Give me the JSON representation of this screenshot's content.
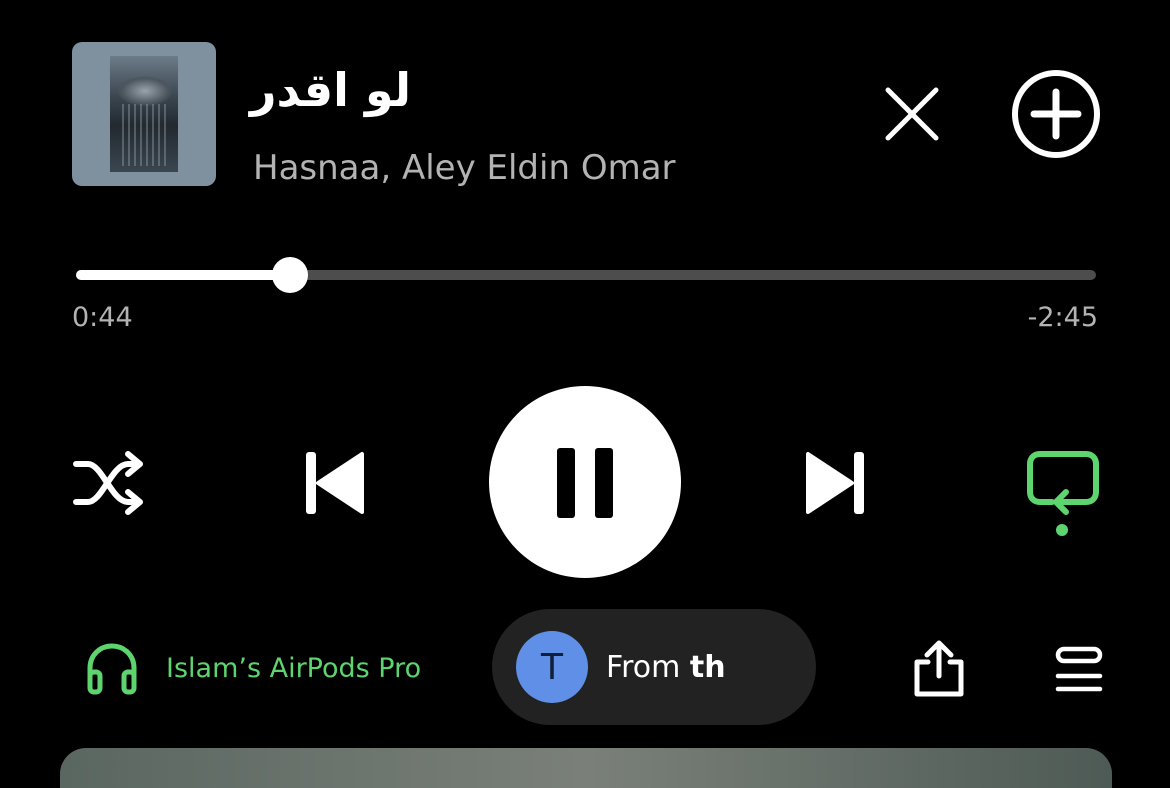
{
  "track": {
    "title": "لو اقدر",
    "artist": "Hasnaa, Aley Eldin Omar"
  },
  "progress": {
    "elapsed": "0:44",
    "remaining": "-2:45",
    "fraction": 0.21
  },
  "device": {
    "name": "Islam’s AirPods Pro"
  },
  "pill": {
    "avatar_letter": "T",
    "text_regular": "From",
    "text_bold": "th"
  },
  "colors": {
    "accent_green": "#5ed46f",
    "avatar_blue": "#5f8fe6",
    "background": "#000000"
  },
  "icons": {
    "close": "close-icon",
    "add": "add-circle-icon",
    "shuffle": "shuffle-icon",
    "previous": "skip-previous-icon",
    "pause": "pause-icon",
    "next": "skip-next-icon",
    "repeat": "repeat-icon",
    "headphones": "headphones-icon",
    "share": "share-icon",
    "queue": "queue-icon"
  }
}
